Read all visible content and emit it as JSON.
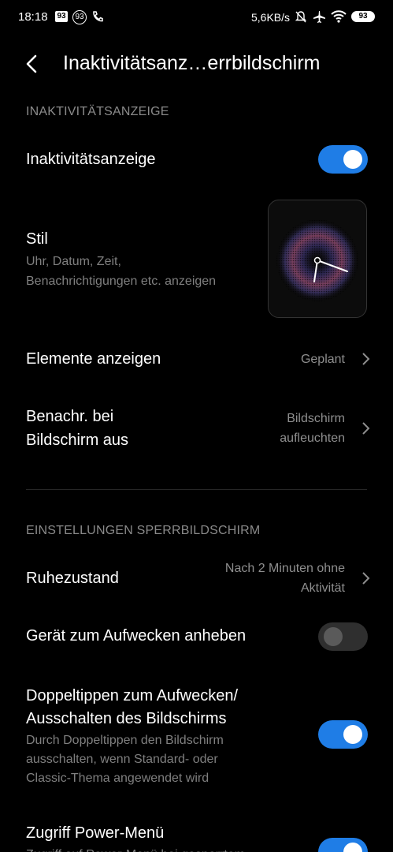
{
  "status_bar": {
    "time": "18:18",
    "badge_1": "93",
    "badge_2": "93",
    "net_speed": "5,6KB/s",
    "battery": "93"
  },
  "header": {
    "title": "Inaktivitätsanz…errbildschirm"
  },
  "sections": {
    "ambient": "INAKTIVITÄTSANZEIGE",
    "lockscreen": "EINSTELLUNGEN SPERRBILDSCHIRM"
  },
  "rows": {
    "ambient_display": {
      "label": "Inaktivitätsanzeige",
      "toggle": "on"
    },
    "style": {
      "label": "Stil",
      "sub_1": "Uhr, Datum, Zeit,",
      "sub_2": "Benachrichtigungen etc. anzeigen"
    },
    "show_elements": {
      "label": "Elemente anzeigen",
      "value": "Geplant"
    },
    "notify_screen_off": {
      "label_1": "Benachr. bei",
      "label_2": "Bildschirm aus",
      "value_1": "Bildschirm",
      "value_2": "aufleuchten"
    },
    "sleep": {
      "label": "Ruhezustand",
      "value_1": "Nach 2 Minuten ohne",
      "value_2": "Aktivität"
    },
    "lift_to_wake": {
      "label": "Gerät zum Aufwecken anheben",
      "toggle": "off"
    },
    "double_tap": {
      "label_1": "Doppeltippen zum Aufwecken/",
      "label_2": "Ausschalten des Bildschirms",
      "sub_1": "Durch Doppeltippen den Bildschirm",
      "sub_2": "ausschalten, wenn Standard- oder",
      "sub_3": "Classic-Thema angewendet wird",
      "toggle": "on"
    },
    "power_menu": {
      "label": "Zugriff Power-Menü",
      "sub": "Zugriff auf Power-Menü bei gesperrtem",
      "toggle": "on"
    }
  },
  "colors": {
    "accent": "#1f7de6",
    "background": "#000000",
    "secondary_text": "#8a8a8a"
  }
}
